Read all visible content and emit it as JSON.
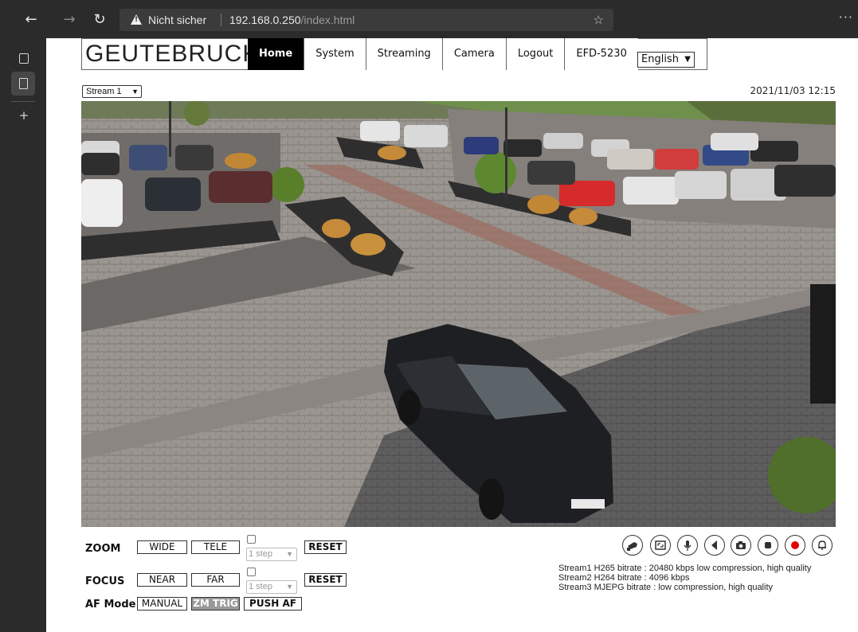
{
  "browser": {
    "security_label": "Nicht sicher",
    "url_host": "192.168.0.250",
    "url_path": "/index.html",
    "more_glyph": "···"
  },
  "header": {
    "logo": "GEUTEBRUCK",
    "nav": [
      "Home",
      "System",
      "Streaming",
      "Camera",
      "Logout",
      "EFD-5230"
    ],
    "active_nav": "Home",
    "language": "English"
  },
  "viewer": {
    "stream_select": "Stream 1",
    "timestamp": "2021/11/03 12:15"
  },
  "controls": {
    "zoom": {
      "label": "ZOOM",
      "wide": "WIDE",
      "tele": "TELE",
      "step": "1 step",
      "reset": "RESET"
    },
    "focus": {
      "label": "FOCUS",
      "near": "NEAR",
      "far": "FAR",
      "step": "1 step",
      "reset": "RESET"
    },
    "af_mode": {
      "label": "AF Mode",
      "manual": "MANUAL",
      "zm_trig": "ZM TRIG",
      "push_af": "PUSH AF",
      "selected": "ZM TRIG"
    }
  },
  "toolbar_icons": [
    "ptz-icon",
    "fullscreen-icon",
    "microphone-icon",
    "speaker-icon",
    "snapshot-icon",
    "stop-icon",
    "record-icon",
    "alarm-icon"
  ],
  "stream_info": [
    "Stream1 H265 bitrate : 20480 kbps low compression, high quality",
    "Stream2 H264 bitrate : 4096 kbps",
    "Stream3 MJEPG bitrate : low compression, high quality"
  ],
  "colors": {
    "record": "#e00000",
    "active_nav_bg": "#000000",
    "pressed_button": "#999999"
  }
}
